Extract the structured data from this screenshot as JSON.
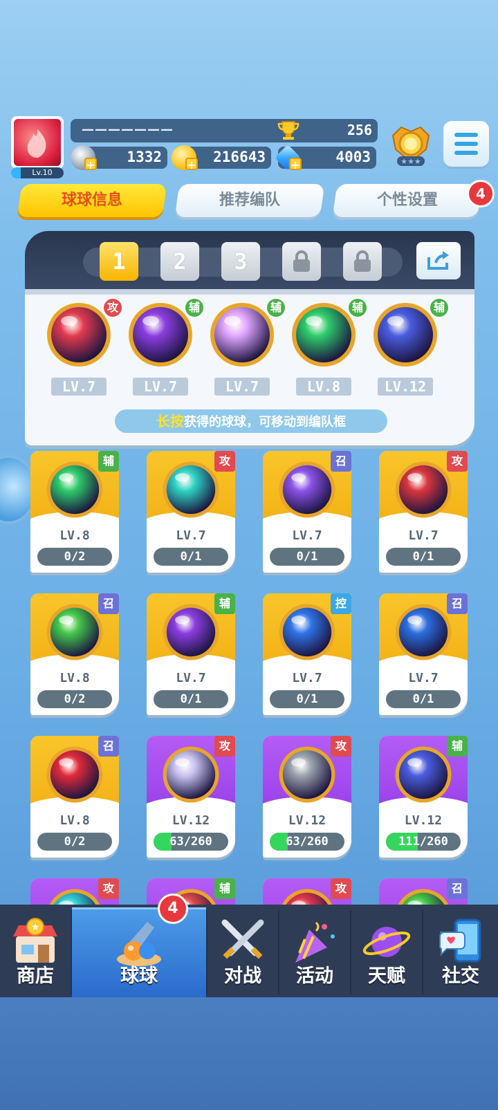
{
  "player": {
    "level": "Lv.10",
    "name": "———————",
    "trophies": "256",
    "stamina": "1332",
    "coins": "216643",
    "gems": "4003"
  },
  "tabs": [
    {
      "label": "球球信息",
      "active": true
    },
    {
      "label": "推荐编队",
      "active": false
    },
    {
      "label": "个性设置",
      "active": false,
      "badge": "4"
    }
  ],
  "formation": {
    "slots": [
      "1",
      "2",
      "3"
    ],
    "selected_slot": "1",
    "locked_slots": 2,
    "team": [
      {
        "role": "攻",
        "level": "LV.7",
        "color": "#e23a4e"
      },
      {
        "role": "辅",
        "level": "LV.7",
        "color": "#8b3ee0"
      },
      {
        "role": "辅",
        "level": "LV.7",
        "color": "#e0a6ff"
      },
      {
        "role": "辅",
        "level": "LV.8",
        "color": "#2ecb6b"
      },
      {
        "role": "辅",
        "level": "LV.12",
        "color": "#4a5de0"
      }
    ],
    "hint_highlight": "长按",
    "hint_text": "获得的球球，可移动到编队框"
  },
  "grid": [
    {
      "role": "辅",
      "role_type": "sup",
      "level": "LV.8",
      "progress": "0/2",
      "fill": 0,
      "theme": "gold",
      "color": "#2ecb6b"
    },
    {
      "role": "攻",
      "role_type": "atk",
      "level": "LV.7",
      "progress": "0/1",
      "fill": 0,
      "theme": "gold",
      "color": "#2ed3c4"
    },
    {
      "role": "召",
      "role_type": "sum",
      "level": "LV.7",
      "progress": "0/1",
      "fill": 0,
      "theme": "gold",
      "color": "#8b52e8"
    },
    {
      "role": "攻",
      "role_type": "atk",
      "level": "LV.7",
      "progress": "0/1",
      "fill": 0,
      "theme": "gold",
      "color": "#d9363e"
    },
    {
      "role": "召",
      "role_type": "sum",
      "level": "LV.8",
      "progress": "0/2",
      "fill": 0,
      "theme": "gold",
      "color": "#44c94a"
    },
    {
      "role": "辅",
      "role_type": "sup",
      "level": "LV.7",
      "progress": "0/1",
      "fill": 0,
      "theme": "gold",
      "color": "#8b3ee0"
    },
    {
      "role": "控",
      "role_type": "ctl",
      "level": "LV.7",
      "progress": "0/1",
      "fill": 0,
      "theme": "gold",
      "color": "#2f74e8"
    },
    {
      "role": "召",
      "role_type": "sum",
      "level": "LV.7",
      "progress": "0/1",
      "fill": 0,
      "theme": "gold",
      "color": "#2b6ee0"
    },
    {
      "role": "召",
      "role_type": "sum",
      "level": "LV.8",
      "progress": "0/2",
      "fill": 0,
      "theme": "gold",
      "color": "#e02a3a"
    },
    {
      "role": "攻",
      "role_type": "atk",
      "level": "LV.12",
      "progress": "63/260",
      "fill": 0.24,
      "theme": "purple",
      "color": "#c9c3f2"
    },
    {
      "role": "攻",
      "role_type": "atk",
      "level": "LV.12",
      "progress": "63/260",
      "fill": 0.24,
      "theme": "purple",
      "color": "#9aa3ad"
    },
    {
      "role": "辅",
      "role_type": "sup",
      "level": "LV.12",
      "progress": "111/260",
      "fill": 0.43,
      "theme": "purple",
      "color": "#4a5de0"
    },
    {
      "role": "攻",
      "role_type": "atk",
      "level": "",
      "progress": "",
      "fill": 0,
      "theme": "purple",
      "color": "#2ecbd4"
    },
    {
      "role": "辅",
      "role_type": "sup",
      "level": "",
      "progress": "",
      "fill": 0,
      "theme": "purple",
      "color": "#e04a4a"
    },
    {
      "role": "攻",
      "role_type": "atk",
      "level": "",
      "progress": "",
      "fill": 0,
      "theme": "purple",
      "color": "#e0364a"
    },
    {
      "role": "召",
      "role_type": "sum",
      "level": "",
      "progress": "",
      "fill": 0,
      "theme": "purple",
      "color": "#44c94a"
    }
  ],
  "nav": [
    {
      "label": "商店",
      "icon": "shop-icon",
      "active": false
    },
    {
      "label": "球球",
      "icon": "balls-icon",
      "active": true,
      "badge": "4"
    },
    {
      "label": "对战",
      "icon": "battle-swords-icon",
      "active": false
    },
    {
      "label": "活动",
      "icon": "party-popper-icon",
      "active": false
    },
    {
      "label": "天赋",
      "icon": "talent-planet-icon",
      "active": false
    },
    {
      "label": "社交",
      "icon": "social-phone-icon",
      "active": false
    }
  ]
}
